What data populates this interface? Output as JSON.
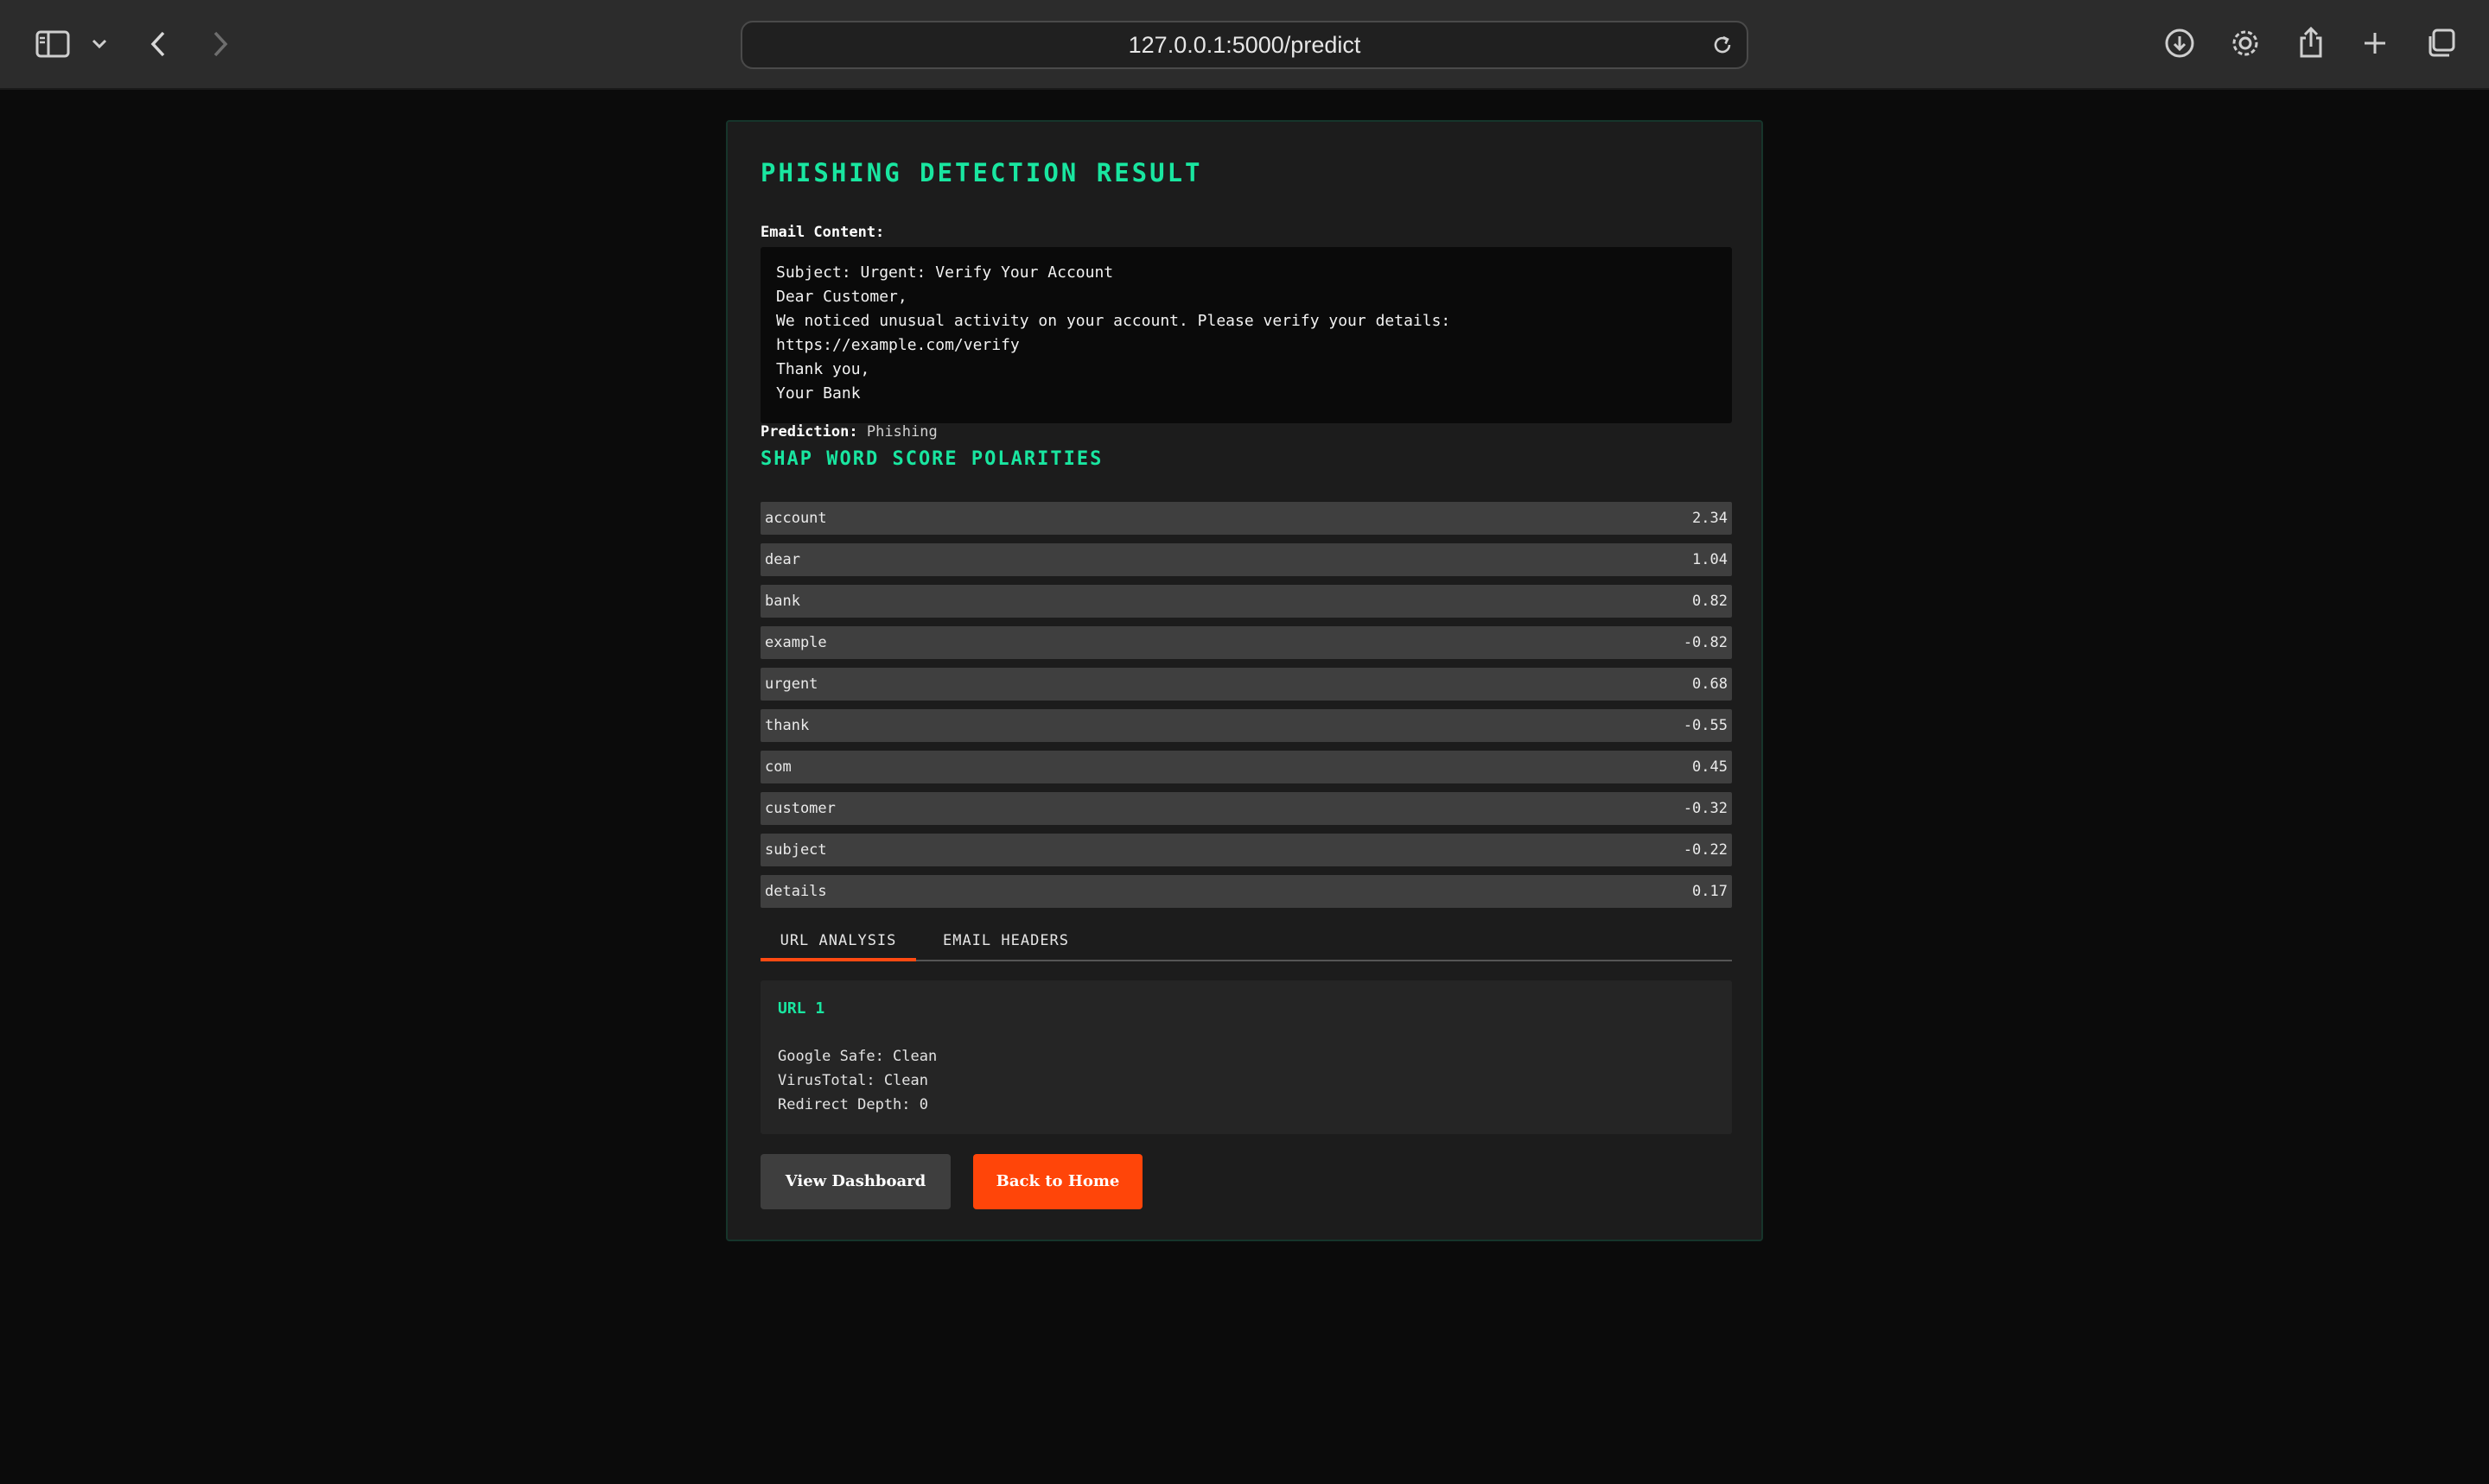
{
  "browser": {
    "url": "127.0.0.1:5000/predict",
    "icons": [
      "sidebar-icon",
      "chevron-down-icon",
      "back-icon",
      "forward-icon",
      "reload-icon",
      "download-icon",
      "gear-icon",
      "share-icon",
      "plus-icon",
      "tabs-icon"
    ]
  },
  "page": {
    "title": "PHISHING DETECTION RESULT",
    "email_label": "Email Content:",
    "email_lines": [
      "Subject: Urgent: Verify Your Account",
      "Dear Customer,",
      "We noticed unusual activity on your account. Please verify your details:",
      "https://example.com/verify",
      "Thank you,",
      "Your Bank"
    ],
    "prediction_label": "Prediction:",
    "prediction_value": "Phishing",
    "shap_title": "SHAP WORD SCORE POLARITIES",
    "shap_scores": [
      {
        "word": "account",
        "value": "2.34"
      },
      {
        "word": "dear",
        "value": "1.04"
      },
      {
        "word": "bank",
        "value": "0.82"
      },
      {
        "word": "example",
        "value": "-0.82"
      },
      {
        "word": "urgent",
        "value": "0.68"
      },
      {
        "word": "thank",
        "value": "-0.55"
      },
      {
        "word": "com",
        "value": "0.45"
      },
      {
        "word": "customer",
        "value": "-0.32"
      },
      {
        "word": "subject",
        "value": "-0.22"
      },
      {
        "word": "details",
        "value": "0.17"
      }
    ],
    "tabs": [
      {
        "label": "URL ANALYSIS",
        "active": true
      },
      {
        "label": "EMAIL HEADERS",
        "active": false
      }
    ],
    "url_analysis": {
      "heading": "URL 1",
      "google_safe": "Google Safe: Clean",
      "virustotal": "VirusTotal: Clean",
      "redirect_depth": "Redirect Depth: 0"
    },
    "buttons": {
      "dashboard": "View Dashboard",
      "home": "Back to Home"
    }
  },
  "colors": {
    "accent_green": "#19e6a0",
    "accent_orange": "#ff4509",
    "background": "#0b0b0b",
    "card": "#1c1c1c"
  }
}
